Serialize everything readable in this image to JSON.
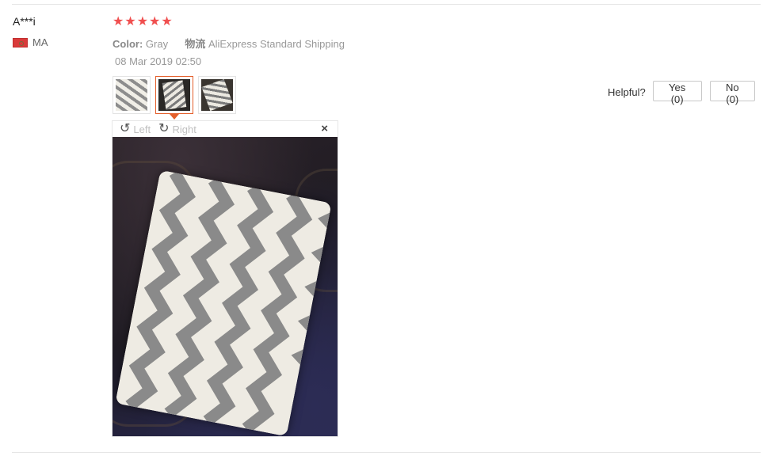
{
  "review": {
    "username": "A***i",
    "country_code": "MA",
    "rating": 5,
    "stars": [
      "★",
      "★",
      "★",
      "★",
      "★"
    ],
    "color_label": "Color:",
    "color_value": "Gray",
    "shipping_label": "物流",
    "shipping_value": "AliExpress Standard Shipping",
    "date": "08 Mar 2019 02:50"
  },
  "viewer": {
    "rotate_left_label": "Left",
    "rotate_right_label": "Right",
    "rotate_left_icon": "↺",
    "rotate_right_icon": "↻",
    "close_icon": "×"
  },
  "helpful": {
    "label": "Helpful?",
    "yes": "Yes (0)",
    "no": "No (0)"
  },
  "colors": {
    "star": "#f04f4f",
    "active_thumb": "#e45f2b"
  }
}
